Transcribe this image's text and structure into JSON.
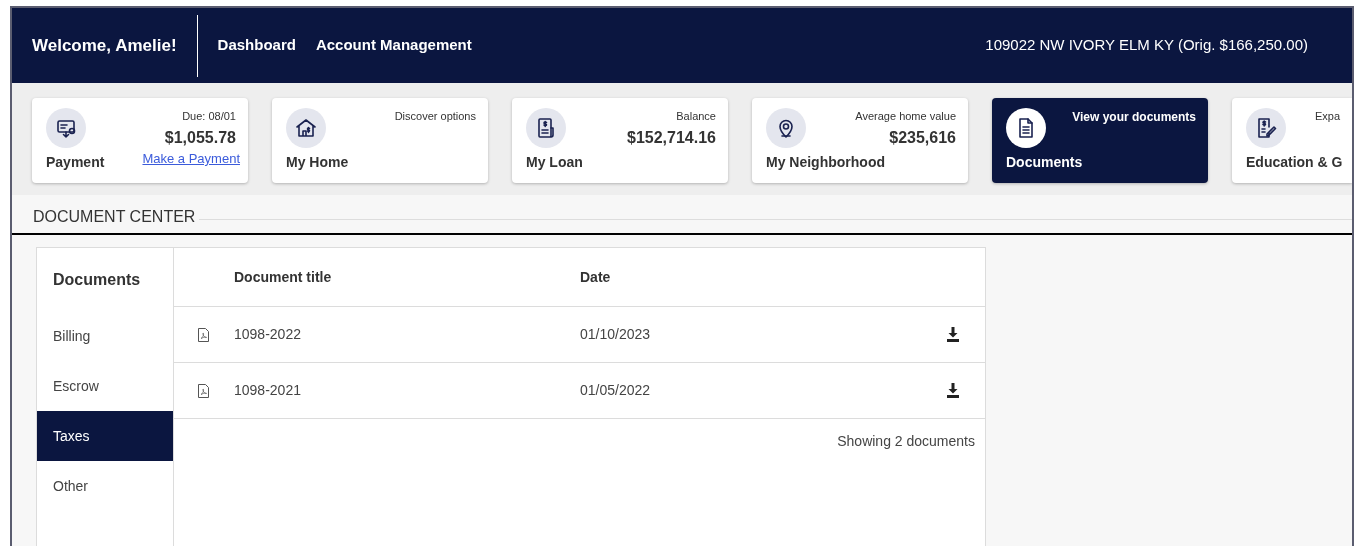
{
  "header": {
    "welcome": "Welcome, Amelie!",
    "nav": [
      {
        "label": "Dashboard"
      },
      {
        "label": "Account Management"
      }
    ],
    "property": "109022 NW IVORY ELM KY (Orig. $166,250.00)"
  },
  "cards": [
    {
      "kind": "payment",
      "title": "Payment",
      "caption": "Due: 08/01",
      "value": "$1,055.78",
      "link": "Make a Payment",
      "selected": false
    },
    {
      "kind": "home",
      "title": "My Home",
      "caption": "Discover options",
      "selected": false
    },
    {
      "kind": "loan",
      "title": "My Loan",
      "caption": "Balance",
      "value": "$152,714.16",
      "selected": false
    },
    {
      "kind": "neighborhood",
      "title": "My Neighborhood",
      "caption": "Average home value",
      "value": "$235,616",
      "selected": false
    },
    {
      "kind": "documents",
      "title": "Documents",
      "caption": "View your documents",
      "selected": true
    },
    {
      "kind": "education",
      "title": "Education & G",
      "caption": "Expa",
      "selected": false
    }
  ],
  "section_title": "DOCUMENT CENTER",
  "sidebar": {
    "heading": "Documents",
    "items": [
      {
        "label": "Billing",
        "selected": false
      },
      {
        "label": "Escrow",
        "selected": false
      },
      {
        "label": "Taxes",
        "selected": true
      },
      {
        "label": "Other",
        "selected": false
      }
    ]
  },
  "table": {
    "columns": [
      "Document title",
      "Date"
    ],
    "rows": [
      {
        "title": "1098-2022",
        "date": "01/10/2023"
      },
      {
        "title": "1098-2021",
        "date": "01/05/2022"
      }
    ],
    "footer": "Showing 2 documents"
  }
}
